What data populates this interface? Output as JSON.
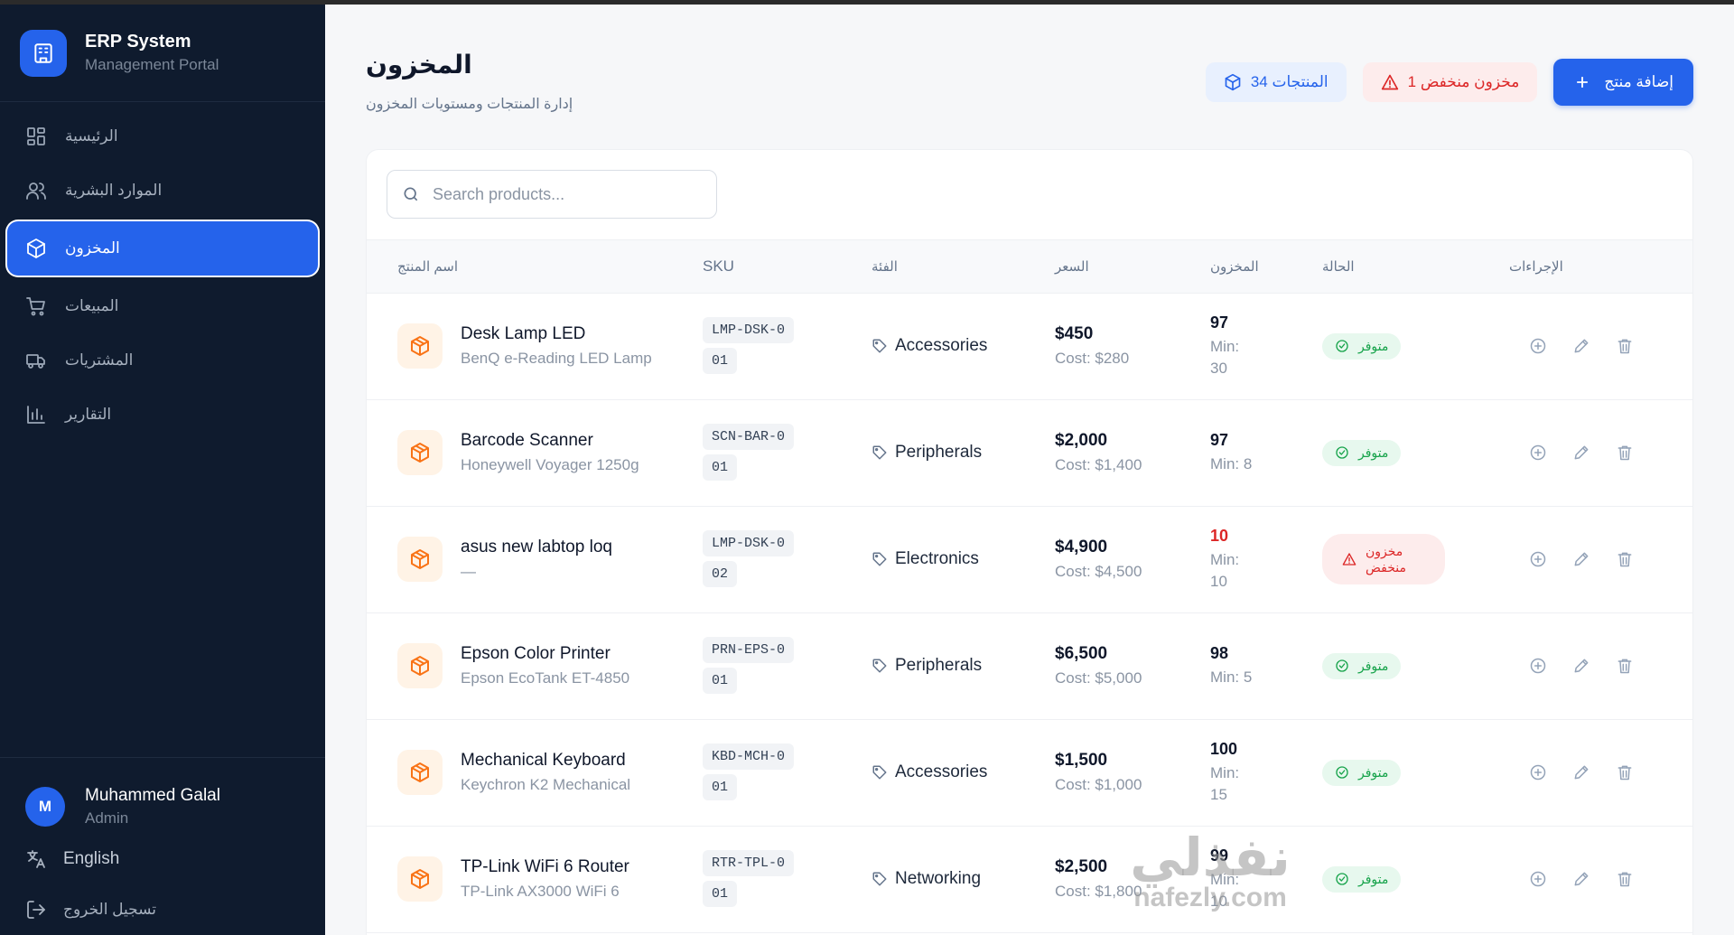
{
  "brand": {
    "title": "ERP System",
    "subtitle": "Management Portal"
  },
  "sidebar": {
    "items": [
      {
        "label": "الرئيسية",
        "icon": "dashboard-icon"
      },
      {
        "label": "الموارد البشرية",
        "icon": "users-icon"
      },
      {
        "label": "المخزون",
        "icon": "box-icon",
        "active": true
      },
      {
        "label": "المبيعات",
        "icon": "cart-icon"
      },
      {
        "label": "المشتريات",
        "icon": "truck-icon"
      },
      {
        "label": "التقارير",
        "icon": "bar-chart-icon"
      }
    ],
    "user": {
      "initial": "M",
      "name": "Muhammed Galal",
      "role": "Admin"
    },
    "language": "English",
    "logout": "تسجيل الخروج"
  },
  "header": {
    "title": "المخزون",
    "subtitle": "إدارة المنتجات ومستويات المخزون",
    "products_chip": "34 المنتجات",
    "low_stock_chip": "1 مخزون منخفض",
    "add_button": "إضافة منتج"
  },
  "search": {
    "placeholder": "Search products..."
  },
  "table": {
    "columns": [
      "اسم المنتج",
      "SKU",
      "الفئة",
      "السعر",
      "المخزون",
      "الحالة",
      "الإجراءات"
    ],
    "rows": [
      {
        "name": "Desk Lamp LED",
        "desc": "BenQ e-Reading LED Lamp",
        "sku": "LMP-DSK-001",
        "category": "Accessories",
        "price": "$450",
        "cost": "Cost: $280",
        "stock": "97",
        "min": "Min: 30",
        "status": "متوفر",
        "low": false
      },
      {
        "name": "Barcode Scanner",
        "desc": "Honeywell Voyager 1250g",
        "sku": "SCN-BAR-001",
        "category": "Peripherals",
        "price": "$2,000",
        "cost": "Cost: $1,400",
        "stock": "97",
        "min": "Min: 8",
        "status": "متوفر",
        "low": false
      },
      {
        "name": "asus new labtop loq",
        "desc": "—",
        "sku": "LMP-DSK-002",
        "category": "Electronics",
        "price": "$4,900",
        "cost": "Cost: $4,500",
        "stock": "10",
        "min": "Min: 10",
        "status": "مخزون منخفض",
        "low": true
      },
      {
        "name": "Epson Color Printer",
        "desc": "Epson EcoTank ET-4850",
        "sku": "PRN-EPS-001",
        "category": "Peripherals",
        "price": "$6,500",
        "cost": "Cost: $5,000",
        "stock": "98",
        "min": "Min: 5",
        "status": "متوفر",
        "low": false
      },
      {
        "name": "Mechanical Keyboard",
        "desc": "Keychron K2 Mechanical",
        "sku": "KBD-MCH-001",
        "category": "Accessories",
        "price": "$1,500",
        "cost": "Cost: $1,000",
        "stock": "100",
        "min": "Min: 15",
        "status": "متوفر",
        "low": false
      },
      {
        "name": "TP-Link WiFi 6 Router",
        "desc": "TP-Link AX3000 WiFi 6",
        "sku": "RTR-TPL-001",
        "category": "Networking",
        "price": "$2,500",
        "cost": "Cost: $1,800",
        "stock": "99",
        "min": "Min: 10",
        "status": "متوفر",
        "low": false
      }
    ]
  },
  "watermark": {
    "arabic": "نفذلي",
    "latin": "nafezly.com"
  },
  "colors": {
    "accent": "#2563eb",
    "sidebar_bg": "#0f1b2e",
    "ok": "#16a34a",
    "danger": "#dc2626",
    "product_icon": "#f97316"
  }
}
